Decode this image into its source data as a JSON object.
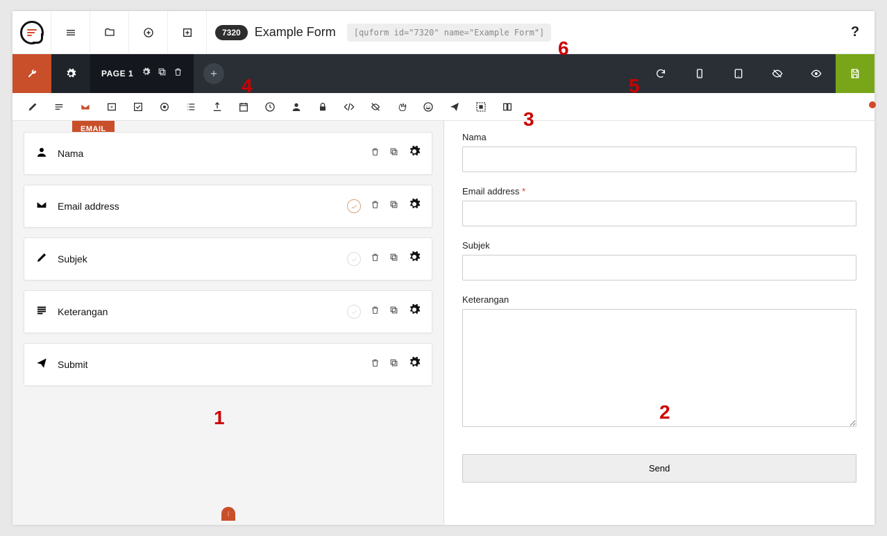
{
  "header": {
    "form_id": "7320",
    "form_title": "Example Form",
    "shortcode": "[quform id=\"7320\" name=\"Example Form\"]"
  },
  "tabbar": {
    "page_label": "PAGE 1"
  },
  "icon_tooltip": "EMAIL",
  "blocks": [
    {
      "icon": "user",
      "label": "Nama",
      "required": null
    },
    {
      "icon": "mail",
      "label": "Email address",
      "required": true
    },
    {
      "icon": "pencil",
      "label": "Subjek",
      "required": false
    },
    {
      "icon": "lines",
      "label": "Keterangan",
      "required": false
    },
    {
      "icon": "send",
      "label": "Submit",
      "required": null
    }
  ],
  "preview": {
    "f1": "Nama",
    "f2": "Email address",
    "f3": "Subjek",
    "f4": "Keterangan",
    "submit": "Send"
  },
  "markers": {
    "m1": "1",
    "m2": "2",
    "m3": "3",
    "m4": "4",
    "m5": "5",
    "m6": "6"
  }
}
